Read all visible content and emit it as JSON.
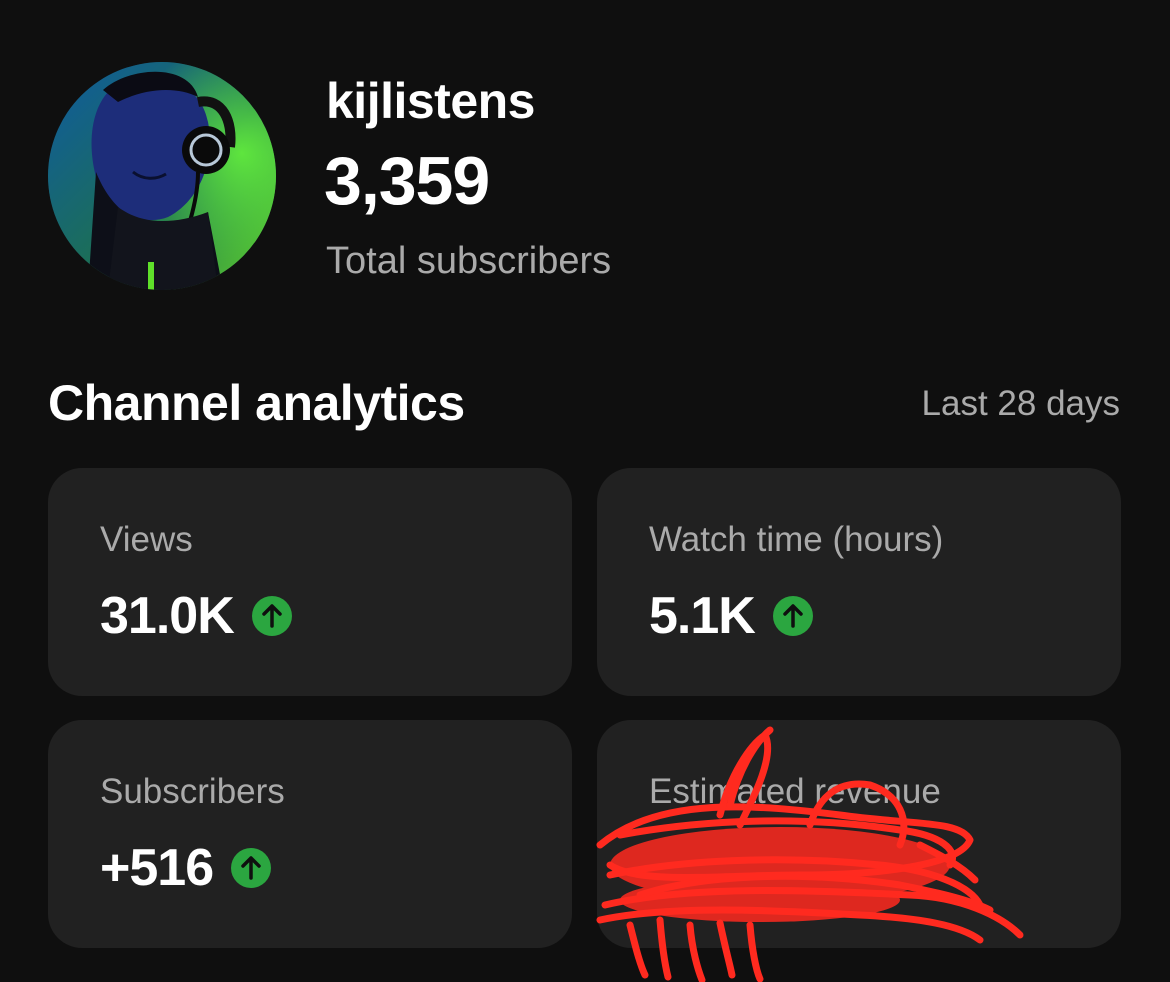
{
  "channel": {
    "name": "kijlistens",
    "subscriber_count": "3,359",
    "subscriber_label": "Total subscribers"
  },
  "analytics": {
    "title": "Channel analytics",
    "period": "Last 28 days",
    "cards": [
      {
        "label": "Views",
        "value": "31.0K",
        "trend": "up"
      },
      {
        "label": "Watch time (hours)",
        "value": "5.1K",
        "trend": "up"
      },
      {
        "label": "Subscribers",
        "value": "+516",
        "trend": "up"
      },
      {
        "label": "Estimated revenue",
        "value": "",
        "trend": ""
      }
    ]
  },
  "colors": {
    "background": "#0f0f0f",
    "card": "#212121",
    "trend_up": "#2ba640",
    "redaction": "#ff2a1f"
  },
  "icons": {
    "trend_up": "arrow-up-circle-icon"
  }
}
